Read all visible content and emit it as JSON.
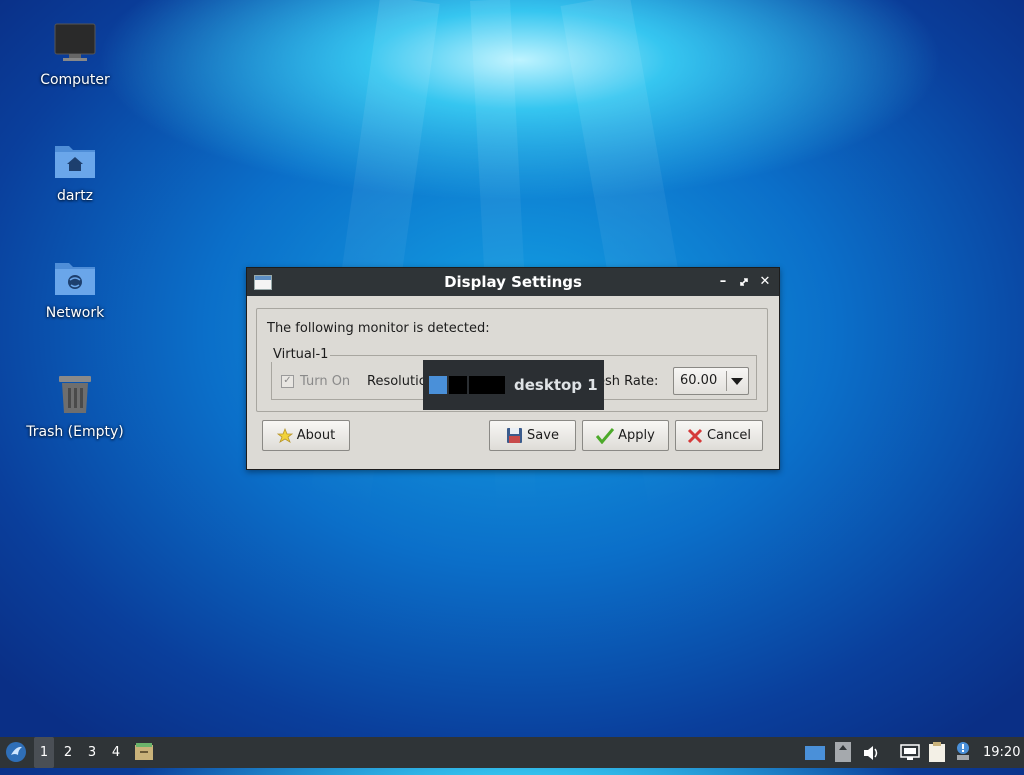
{
  "desktop": {
    "icons": [
      {
        "label": "Computer",
        "icon": "monitor-icon"
      },
      {
        "label": "dartz",
        "icon": "home-folder-icon"
      },
      {
        "label": "Network",
        "icon": "network-folder-icon"
      },
      {
        "label": "Trash (Empty)",
        "icon": "trash-icon"
      }
    ]
  },
  "dialog": {
    "title": "Display Settings",
    "detected_text": "The following monitor is detected:",
    "monitor": {
      "name": "Virtual-1",
      "turn_on_label": "Turn On",
      "turn_on_checked": true,
      "resolution_label": "Resolutio",
      "refresh_label": "esh Rate:",
      "refresh_value": "60.00"
    },
    "buttons": {
      "about": "About",
      "save": "Save",
      "apply": "Apply",
      "cancel": "Cancel"
    }
  },
  "desktop_switcher": {
    "label": "desktop 1",
    "workspaces": 4,
    "active": 1
  },
  "taskbar": {
    "workspaces": [
      "1",
      "2",
      "3",
      "4"
    ],
    "active_workspace": "1",
    "clock": "19:20"
  },
  "colors": {
    "titlebar": "#2f3437",
    "taskbar": "#2f3437",
    "active_workspace": "#4a90d9"
  }
}
